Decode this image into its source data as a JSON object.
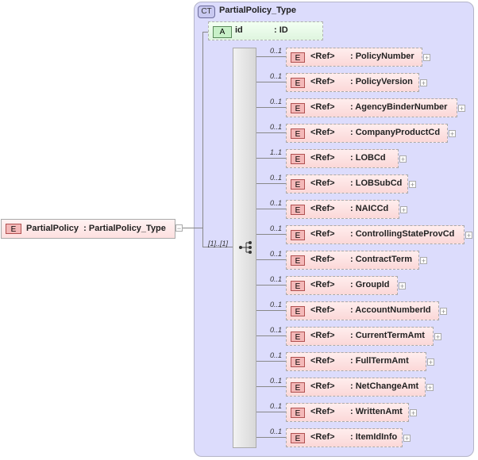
{
  "root": {
    "badge": "E",
    "name": "PartialPolicy",
    "type": ": PartialPolicy_Type",
    "collapse": "−"
  },
  "complex_type": {
    "badge": "CT",
    "title": "PartialPolicy_Type"
  },
  "attribute": {
    "badge": "A",
    "name": "id",
    "type": ": ID"
  },
  "sequence": {
    "multiplicity": "[1]..[1]"
  },
  "elements": [
    {
      "mult": "0..1",
      "badge": "E",
      "ref": "<Ref>",
      "type": ": PolicyNumber",
      "w": 172
    },
    {
      "mult": "0..1",
      "badge": "E",
      "ref": "<Ref>",
      "type": ": PolicyVersion",
      "w": 168
    },
    {
      "mult": "0..1",
      "badge": "E",
      "ref": "<Ref>",
      "type": ": AgencyBinderNumber",
      "w": 216
    },
    {
      "mult": "0..1",
      "badge": "E",
      "ref": "<Ref>",
      "type": ": CompanyProductCd",
      "w": 204
    },
    {
      "mult": "1..1",
      "badge": "E",
      "ref": "<Ref>",
      "type": ": LOBCd",
      "w": 142
    },
    {
      "mult": "0..1",
      "badge": "E",
      "ref": "<Ref>",
      "type": ": LOBSubCd",
      "w": 154
    },
    {
      "mult": "0..1",
      "badge": "E",
      "ref": "<Ref>",
      "type": ": NAICCd",
      "w": 143
    },
    {
      "mult": "0..1",
      "badge": "E",
      "ref": "<Ref>",
      "type": ": ControllingStateProvCd",
      "w": 225
    },
    {
      "mult": "0..1",
      "badge": "E",
      "ref": "<Ref>",
      "type": ": ContractTerm",
      "w": 168
    },
    {
      "mult": "0..1",
      "badge": "E",
      "ref": "<Ref>",
      "type": ": GroupId",
      "w": 141
    },
    {
      "mult": "0..1",
      "badge": "E",
      "ref": "<Ref>",
      "type": ": AccountNumberId",
      "w": 193
    },
    {
      "mult": "0..1",
      "badge": "E",
      "ref": "<Ref>",
      "type": ": CurrentTermAmt",
      "w": 186
    },
    {
      "mult": "0..1",
      "badge": "E",
      "ref": "<Ref>",
      "type": ": FullTermAmt",
      "w": 177
    },
    {
      "mult": "0..1",
      "badge": "E",
      "ref": "<Ref>",
      "type": ": NetChangeAmt",
      "w": 176
    },
    {
      "mult": "0..1",
      "badge": "E",
      "ref": "<Ref>",
      "type": ": WrittenAmt",
      "w": 155
    },
    {
      "mult": "0..1",
      "badge": "E",
      "ref": "<Ref>",
      "type": ": ItemIdInfo",
      "w": 147
    }
  ],
  "expand_symbol": "+"
}
